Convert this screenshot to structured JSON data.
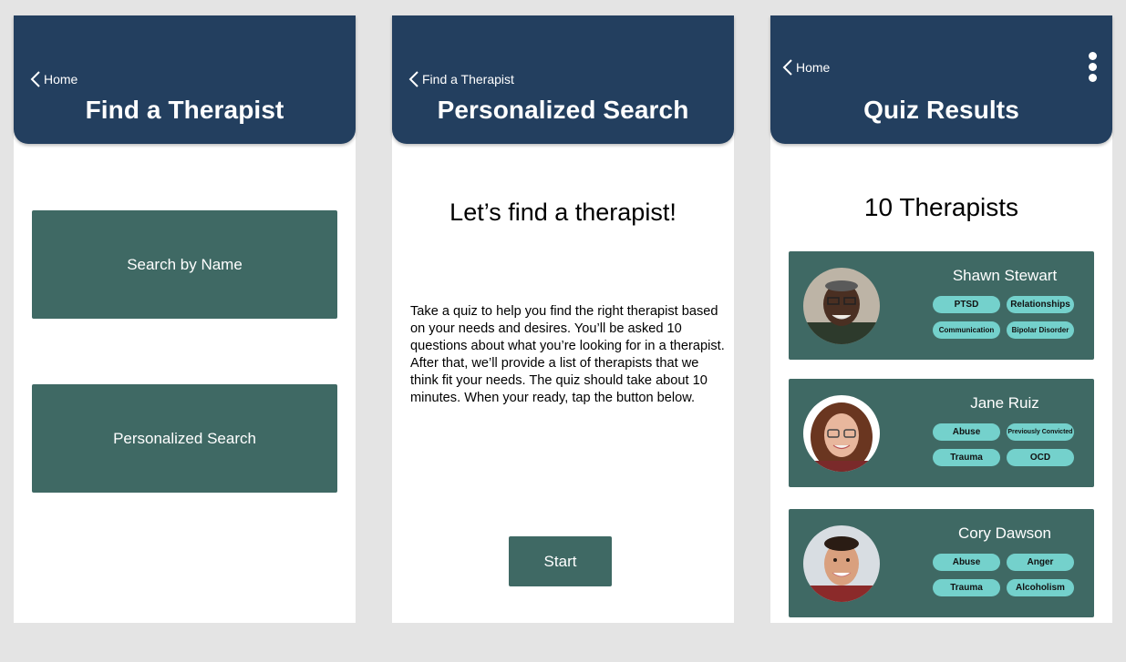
{
  "screens": [
    {
      "back_label": "Home",
      "title": "Find a Therapist",
      "buttons": [
        "Search by Name",
        "Personalized Search"
      ]
    },
    {
      "back_label": "Find a Therapist",
      "title": "Personalized Search",
      "heading": "Let’s find a therapist!",
      "paragraph": "Take a quiz to help you find the right therapist based on your needs and desires. You’ll be asked 10 questions about what you’re looking for in a therapist. After that, we’ll provide a list of therapists that we think fit your needs.  The quiz should take about 10 minutes. When your ready, tap the button below.",
      "start_label": "Start"
    },
    {
      "back_label": "Home",
      "title": "Quiz Results",
      "count_label": "10 Therapists",
      "therapists": [
        {
          "name": "Shawn Stewart",
          "tags": [
            "PTSD",
            "Relationships",
            "Communication",
            "Bipolar Disorder"
          ]
        },
        {
          "name": "Jane Ruiz",
          "tags": [
            "Abuse",
            "Previously Convicted",
            "Trauma",
            "OCD"
          ]
        },
        {
          "name": "Cory Dawson",
          "tags": [
            "Abuse",
            "Anger",
            "Trauma",
            "Alcoholism"
          ]
        }
      ]
    }
  ],
  "colors": {
    "header": "#233f5f",
    "button": "#3f6964",
    "tag": "#74d1cc",
    "background": "#e4e4e4"
  },
  "icons": {
    "back": "chevron-left-icon",
    "menu": "more-vertical-icon"
  }
}
